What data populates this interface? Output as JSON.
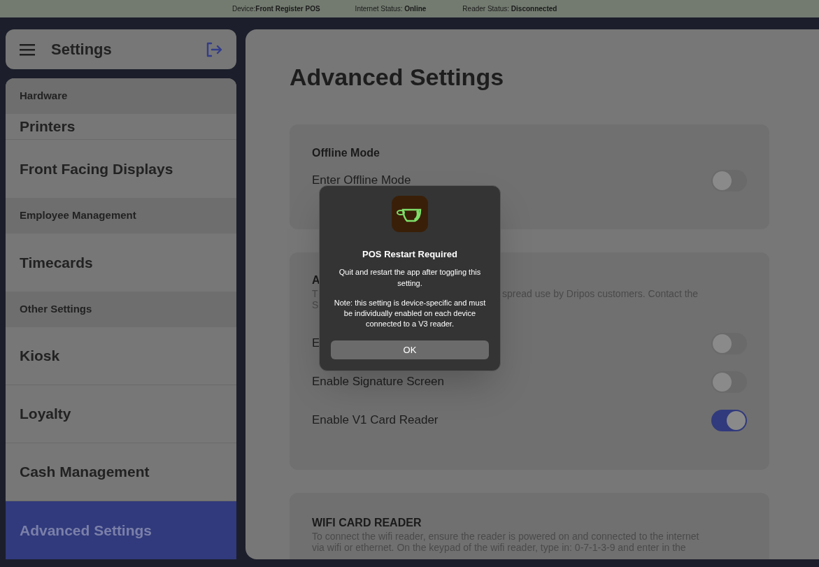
{
  "status_bar": [
    {
      "label": "Device:",
      "value": "Front Register POS"
    },
    {
      "label": "Internet Status: ",
      "value": "Online"
    },
    {
      "label": "Reader Status: ",
      "value": "Disconnected"
    }
  ],
  "sidebar": {
    "title": "Settings",
    "sections": [
      {
        "heading": "Hardware",
        "items": [
          {
            "label": "Printers",
            "selected": false,
            "kind": "short"
          },
          {
            "label": "Front Facing Displays",
            "selected": false,
            "kind": "full"
          }
        ]
      },
      {
        "heading": "Employee Management",
        "items": [
          {
            "label": "Timecards",
            "selected": false,
            "kind": "full"
          }
        ]
      },
      {
        "heading": "Other Settings",
        "items": [
          {
            "label": "Kiosk",
            "selected": false,
            "kind": "full"
          },
          {
            "label": "Loyalty",
            "selected": false,
            "kind": "full"
          },
          {
            "label": "Cash Management",
            "selected": false,
            "kind": "full"
          },
          {
            "label": "Advanced Settings",
            "selected": true,
            "kind": "full"
          }
        ]
      }
    ]
  },
  "page_title": "Advanced Settings",
  "cards": [
    {
      "heading": "Offline Mode",
      "toggles": [
        {
          "label": "Enter Offline Mode",
          "on": false
        }
      ]
    },
    {
      "heading": "A",
      "description": [
        [
          "T",
          "spread use by Dripos customers. Contact the"
        ],
        [
          "S"
        ]
      ],
      "toggles": [
        {
          "label": "E",
          "on": false
        },
        {
          "label": "Enable Signature Screen",
          "on": false
        },
        {
          "label": "Enable V1 Card Reader",
          "on": true
        }
      ]
    },
    {
      "heading": "WIFI CARD READER",
      "description": [
        [
          "To connect the wifi reader, ensure the reader is powered on and connected to the internet"
        ],
        [
          "via wifi or ethernet. On the keypad of the wifi reader, type in: 0-7-1-3-9 and enter in the"
        ]
      ]
    }
  ],
  "dialog": {
    "title": "POS Restart Required",
    "message": "Quit and restart the app after toggling this setting.",
    "note": "Note: this setting is device-specific and must be individually enabled on each device connected to a V3 reader.",
    "button": "OK"
  }
}
